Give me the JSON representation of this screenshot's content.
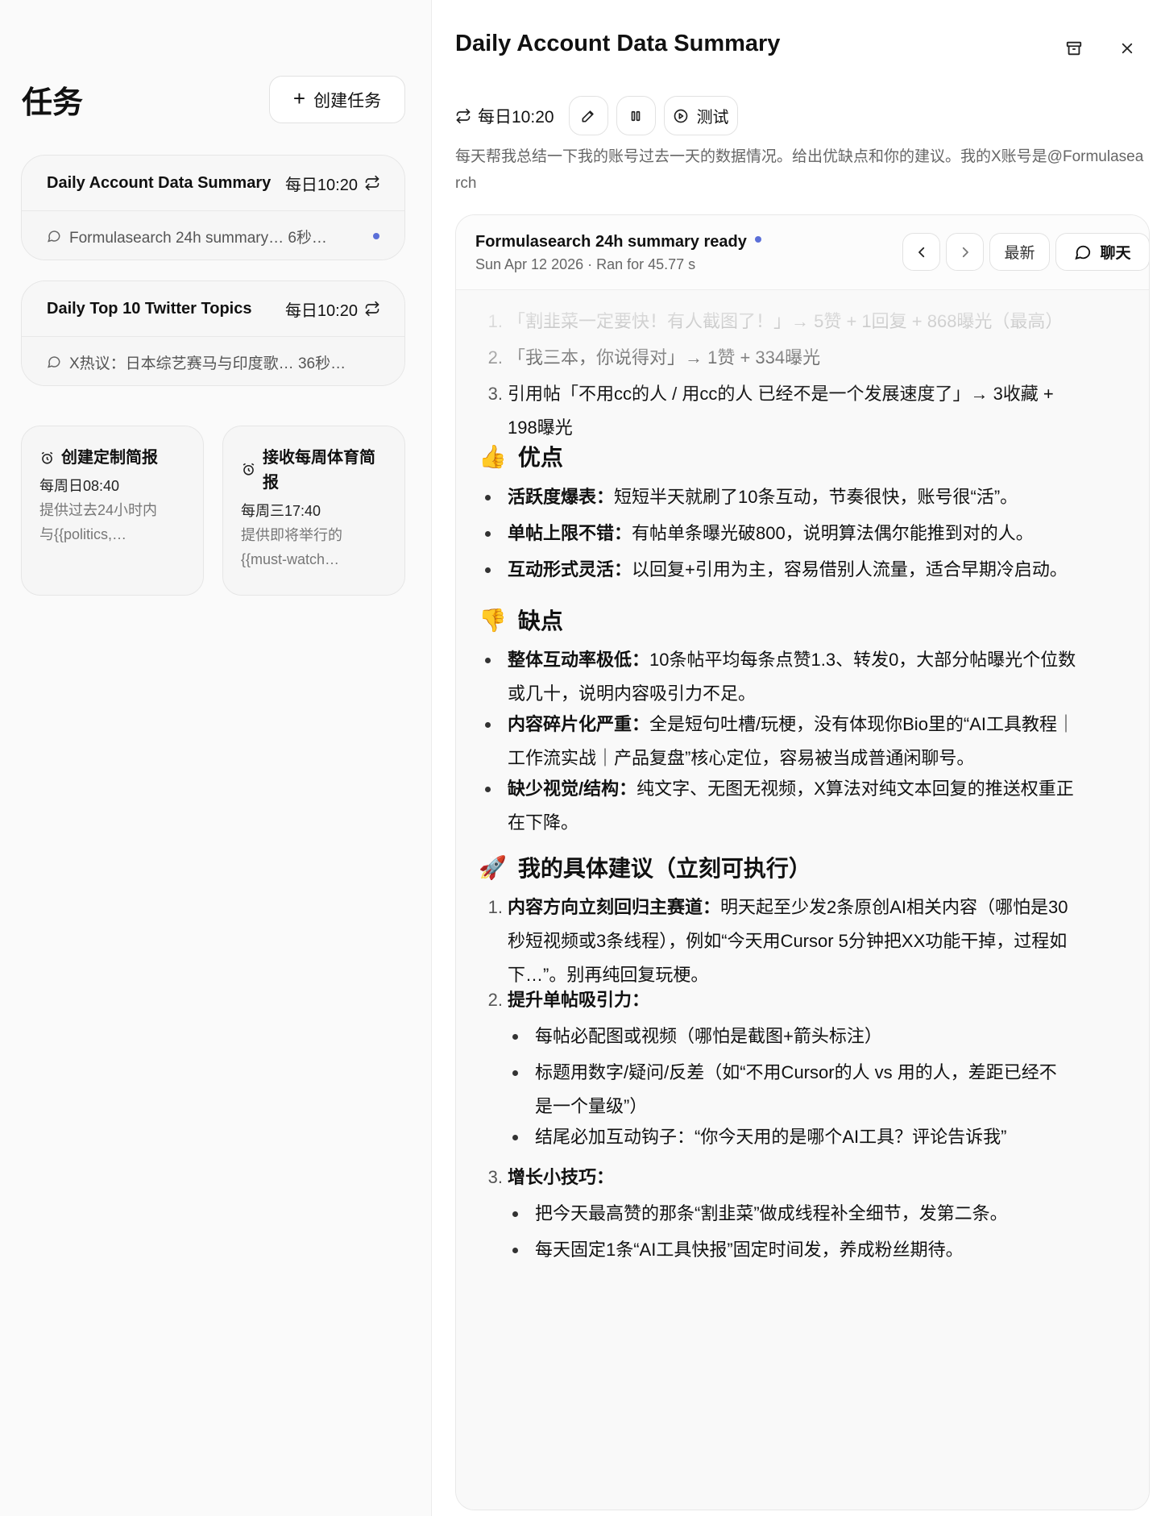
{
  "left": {
    "title": "任务",
    "create_label": "创建任务",
    "tasks": [
      {
        "name": "Daily Account Data Summary",
        "schedule": "每日10:20",
        "last_run": "Formulasearch 24h summary… 6秒…"
      },
      {
        "name": "Daily Top 10 Twitter Topics",
        "schedule": "每日10:20",
        "last_run": "X热议：日本综艺赛马与印度歌… 36秒…"
      }
    ],
    "templates": [
      {
        "title": "创建定制简报",
        "schedule": "每周日08:40",
        "desc1": "提供过去24小时内",
        "desc2": "与{{politics,…"
      },
      {
        "title1": "接收每周体育简",
        "title2": "报",
        "schedule": "每周三17:40",
        "desc1": "提供即将举行的",
        "desc2": "{{must-watch…"
      }
    ]
  },
  "detail": {
    "title": "Daily Account Data Summary",
    "schedule": "每日10:20",
    "test_label": "测试",
    "prompt": "每天帮我总结一下我的账号过去一天的数据情况。给出优缺点和你的建议。我的X账号是@Formulasearch",
    "run": {
      "title": "Formulasearch 24h summary ready",
      "meta": "Sun Apr 12 2026 · Ran for 45.77 s",
      "latest_label": "最新",
      "chat_label": "聊天"
    },
    "content": {
      "top_list": [
        "「割韭菜一定要快！有人截图了！」→ 5赞 + 1回复 + 868曝光（最高）",
        "「我三本，你说得对」→ 1赞 + 334曝光",
        "引用帖「不用cc的人 / 用cc的人 已经不是一个发展速度了」→ 3收藏 +",
        "198曝光"
      ],
      "pros_heading": "优点",
      "pros": [
        {
          "k": "活跃度爆表：",
          "v": "短短半天就刷了10条互动，节奏很快，账号很“活”。"
        },
        {
          "k": "单帖上限不错：",
          "v": "有帖单条曝光破800，说明算法偶尔能推到对的人。"
        },
        {
          "k": "互动形式灵活：",
          "v": "以回复+引用为主，容易借别人流量，适合早期冷启动。"
        }
      ],
      "cons_heading": "缺点",
      "cons": [
        {
          "k": "整体互动率极低：",
          "v1": "10条帖平均每条点赞1.3、转发0，大部分帖曝光个位数",
          "v2": "或几十，说明内容吸引力不足。"
        },
        {
          "k": "内容碎片化严重：",
          "v1": "全是短句吐槽/玩梗，没有体现你Bio里的“AI工具教程｜",
          "v2": "工作流实战｜产品复盘”核心定位，容易被当成普通闲聊号。"
        },
        {
          "k": "缺少视觉/结构：",
          "v1": "纯文字、无图无视频，X算法对纯文本回复的推送权重正",
          "v2": "在下降。"
        }
      ],
      "advice_heading": "我的具体建议（立刻可执行）",
      "advice": {
        "a1_k": "内容方向立刻回归主赛道：",
        "a1_v1": "明天起至少发2条原创AI相关内容（哪怕是30",
        "a1_v2": "秒短视频或3条线程），例如“今天用Cursor 5分钟把XX功能干掉，过程如",
        "a1_v3": "下…”。别再纯回复玩梗。",
        "a2_k": "提升单帖吸引力：",
        "a2_sub": [
          "每帖必配图或视频（哪怕是截图+箭头标注）",
          "标题用数字/疑问/反差（如“不用Cursor的人 vs 用的人，差距已经不",
          "是一个量级”）",
          "结尾必加互动钩子：“你今天用的是哪个AI工具？评论告诉我”"
        ],
        "a3_k": "增长小技巧：",
        "a3_sub": [
          "把今天最高赞的那条“割韭菜”做成线程补全细节，发第二条。",
          "每天固定1条“AI工具快报”固定时间发，养成粉丝期待。"
        ]
      }
    }
  }
}
